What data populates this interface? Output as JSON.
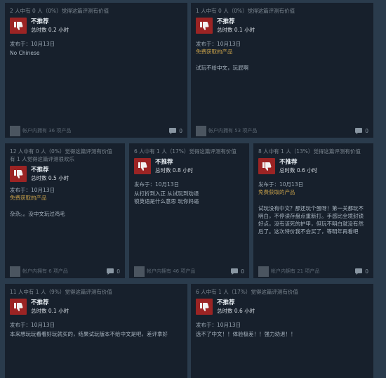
{
  "reviews": [
    {
      "helpful": "2 人中有 0 人（0%）觉得这篇评测有价值",
      "helpful2": "",
      "verdict": "不推荐",
      "hours": "总时数 0.2 小时",
      "posted": "发布于：10月13日",
      "free": "",
      "text": "No Chinese",
      "products": "帐户内拥有 36 项产品",
      "comments": "0"
    },
    {
      "helpful": "1 人中有 0 人（0%）觉得这篇评测有价值",
      "helpful2": "",
      "verdict": "不推荐",
      "hours": "总时数 0.1 小时",
      "posted": "发布于：10月13日",
      "free": "免费获取的产品",
      "text": "试玩不给中文，玩屁啊",
      "products": "帐户内拥有 53 项产品",
      "comments": "0"
    },
    {
      "helpful": "12 人中有 0 人（0%）觉得这篇评测有价值",
      "helpful2": "有 1 人觉得这篇评测很欢乐",
      "verdict": "不推荐",
      "hours": "总时数 0.5 小时",
      "posted": "发布于：10月13日",
      "free": "免费获取的产品",
      "text": "杂杂。。没中文玩过鸡毛",
      "products": "帐户内拥有 6 项产品",
      "comments": "0"
    },
    {
      "helpful": "6 人中有 1 人（17%）觉得这篇评测有价值",
      "helpful2": "",
      "verdict": "不推荐",
      "hours": "总时数 0.8 小时",
      "posted": "发布于：10月13日",
      "free": "",
      "text": "从打折到入正 从试玩到劝退\n锁英语是什么意思 玩你妈逼",
      "products": "帐户内拥有 46 项产品",
      "comments": "0"
    },
    {
      "helpful": "8 人中有 1 人（13%）觉得这篇评测有价值",
      "helpful2": "",
      "verdict": "不推荐",
      "hours": "总时数 0.6 小时",
      "posted": "发布于：10月13日",
      "free": "免费获取的产品",
      "text": "试玩没有中文？那还玩个蛋呀！第一关都玩不明白，不停读存盘点重新打。手感比全境封锁好点，没有该死的护甲，但玩不明白就没有然后了。这次特价我不会买了，等明年再看吧",
      "products": "帐户内拥有 21 项产品",
      "comments": "0"
    },
    {
      "helpful": "11 人中有 1 人（9%）觉得这篇评测有价值",
      "helpful2": "",
      "verdict": "不推荐",
      "hours": "总时数 0.1 小时",
      "posted": "发布于：10月13日",
      "free": "",
      "text": "本来想玩玩看看好玩就买的，结果试玩版本不给中文是吧，差评拿好",
      "products": "",
      "comments": ""
    },
    {
      "helpful": "6 人中有 1 人（17%）觉得这篇评测有价值",
      "helpful2": "",
      "verdict": "不推荐",
      "hours": "总时数 0.6 小时",
      "posted": "发布于：10月13日",
      "free": "",
      "text": "选不了中文！！体验极差！！强力劝退！！",
      "products": "",
      "comments": ""
    }
  ],
  "icons": {
    "verdict": "thumbs-down-icon",
    "comment": "comment-icon",
    "thumb_bg": "#9b2424"
  }
}
